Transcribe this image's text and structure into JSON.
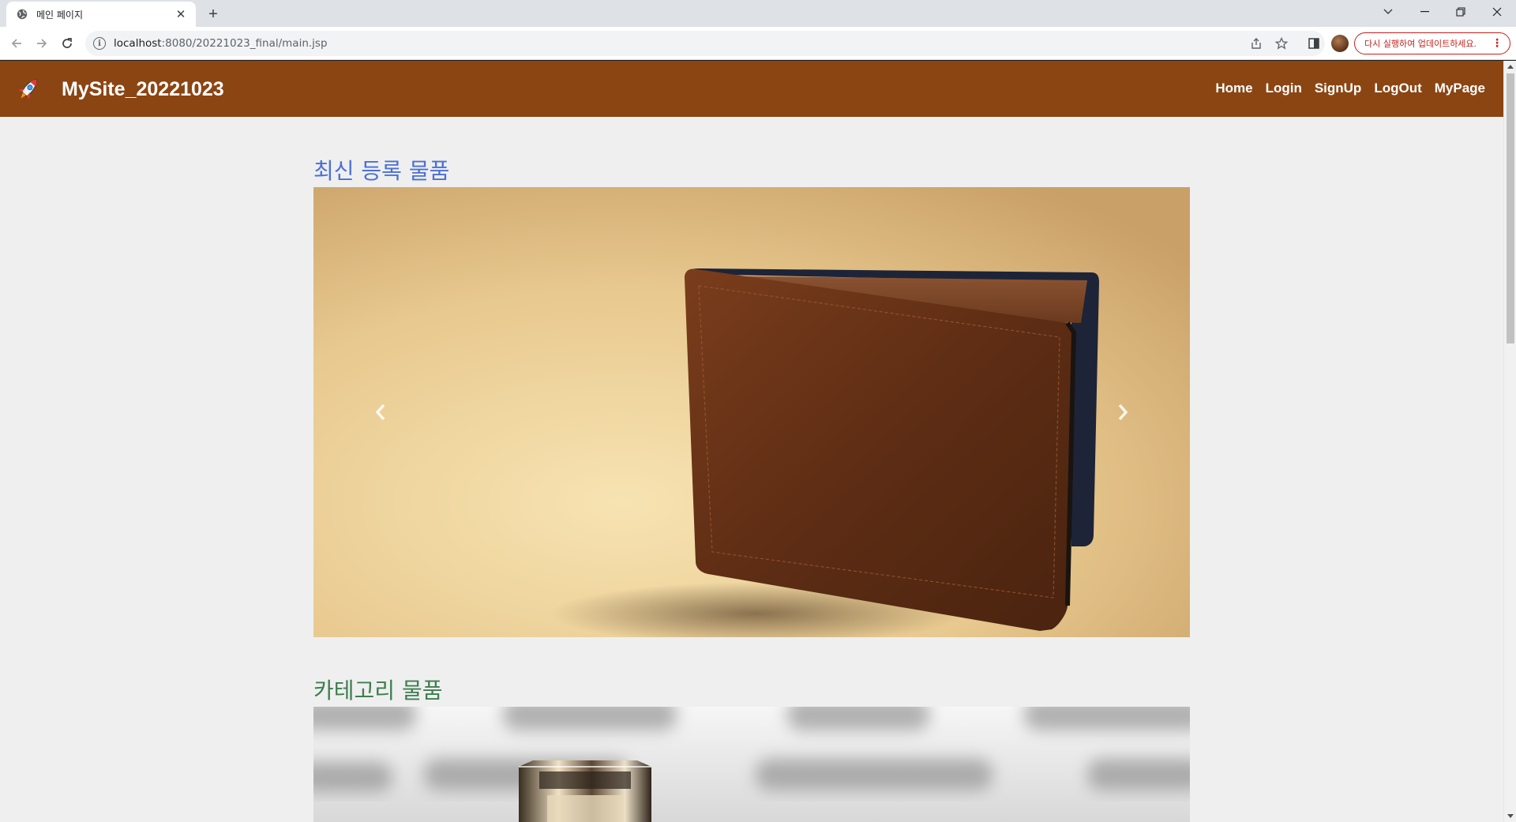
{
  "browser": {
    "tab_title": "메인 페이지",
    "url_host": "localhost",
    "url_path": ":8080/20221023_final/main.jsp",
    "update_label": "다시 실행하여 업데이트하세요."
  },
  "site": {
    "brand": "MySite_20221023",
    "menu": [
      "Home",
      "Login",
      "SignUp",
      "LogOut",
      "MyPage"
    ],
    "accent": "#8b4513"
  },
  "sections": {
    "latest_title": "최신 등록 물품",
    "category_title": "카테고리 물품"
  },
  "icons": {
    "tab": "globe-icon",
    "logo": "rocket-icon",
    "carousel_prev": "chevron-left-icon",
    "carousel_next": "chevron-right-icon"
  }
}
